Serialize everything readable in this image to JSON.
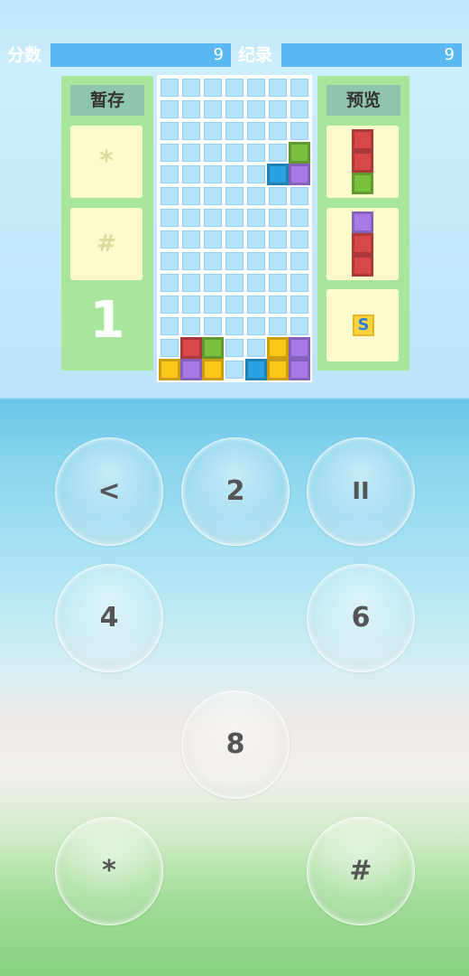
{
  "header": {
    "score_label": "分数",
    "score_value": "9",
    "record_label": "纪录",
    "record_value": "9"
  },
  "hold_panel": {
    "title": "暂存",
    "slot1_symbol": "*",
    "slot2_symbol": "#",
    "level": "1"
  },
  "preview_panel": {
    "title": "预览",
    "bonus_tile": "S"
  },
  "colors": {
    "red": "#d84848",
    "green": "#78c03c",
    "purple": "#a87ae8",
    "yellow": "#ffc61a",
    "blue": "#28a2e0",
    "cell": "#b4e2fb",
    "score_bar": "#5cb8f0",
    "panel": "#a8e79b"
  },
  "board": {
    "columns": 7,
    "rows": 14,
    "pieces": [
      {
        "row": 3,
        "col": 6,
        "color": "green"
      },
      {
        "row": 4,
        "col": 5,
        "color": "blue"
      },
      {
        "row": 4,
        "col": 6,
        "color": "purple"
      },
      {
        "row": 12,
        "col": 1,
        "color": "red"
      },
      {
        "row": 12,
        "col": 2,
        "color": "green"
      },
      {
        "row": 12,
        "col": 5,
        "color": "yellow"
      },
      {
        "row": 12,
        "col": 6,
        "color": "purple"
      },
      {
        "row": 13,
        "col": 0,
        "color": "yellow"
      },
      {
        "row": 13,
        "col": 1,
        "color": "purple"
      },
      {
        "row": 13,
        "col": 2,
        "color": "yellow"
      },
      {
        "row": 13,
        "col": 4,
        "color": "blue"
      },
      {
        "row": 13,
        "col": 5,
        "color": "yellow"
      },
      {
        "row": 13,
        "col": 6,
        "color": "purple"
      }
    ]
  },
  "preview": [
    [
      "red",
      "red",
      "green"
    ],
    [
      "purple",
      "red",
      "red"
    ]
  ],
  "keys": {
    "back": "<",
    "up": "2",
    "pause": "II",
    "left": "4",
    "right": "6",
    "down": "8",
    "star": "*",
    "hash": "#"
  }
}
